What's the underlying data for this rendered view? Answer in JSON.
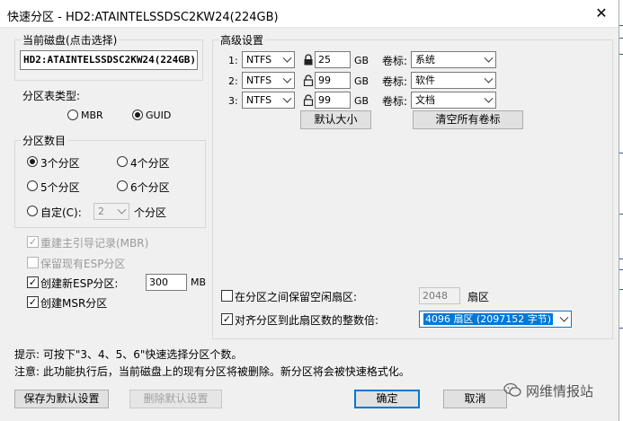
{
  "window": {
    "title": "快速分区 - HD2:ATAINTELSSDSC2KW24(224GB)",
    "close_glyph": "✕"
  },
  "disk": {
    "group_label": "当前磁盘(点击选择)",
    "value": "HD2:ATAINTELSSDSC2KW24(224GB)"
  },
  "partition_table": {
    "label": "分区表类型:",
    "mbr": "MBR",
    "guid": "GUID",
    "selected": "GUID"
  },
  "partition_count": {
    "group_label": "分区数目",
    "options": [
      "3个分区",
      "4个分区",
      "5个分区",
      "6个分区"
    ],
    "custom_label": "自定(C):",
    "custom_value": "2",
    "custom_suffix": "个分区",
    "selected": "3个分区"
  },
  "options_left": {
    "rebuild_mbr": "重建主引导记录(MBR)",
    "keep_esp": "保留现有ESP分区",
    "create_esp": "创建新ESP分区:",
    "esp_size": "300",
    "esp_unit": "MB",
    "create_msr": "创建MSR分区"
  },
  "advanced": {
    "group_label": "高级设置",
    "unit": "GB",
    "volume_label_caption": "卷标:",
    "rows": [
      {
        "index": "1:",
        "fs": "NTFS",
        "size": "25",
        "label": "系统"
      },
      {
        "index": "2:",
        "fs": "NTFS",
        "size": "99",
        "label": "软件"
      },
      {
        "index": "3:",
        "fs": "NTFS",
        "size": "99",
        "label": "文档"
      }
    ],
    "default_size_button": "默认大小",
    "clear_labels_button": "清空所有卷标",
    "reserve_gap_label": "在分区之间保留空闲扇区:",
    "reserve_gap_value": "2048",
    "reserve_gap_unit": "扇区",
    "align_label": "对齐分区到此扇区数的整数倍:",
    "align_value": "4096 扇区 (2097152 字节)"
  },
  "hints": {
    "tip": "提示: 可按下\"3、4、5、6\"快速选择分区个数。",
    "note": "注意: 此功能执行后，当前磁盘上的现有分区将被删除。新分区将会被快速格式化。"
  },
  "buttons": {
    "save_default": "保存为默认设置",
    "delete_default": "删除默认设置",
    "ok": "确定",
    "cancel": "取消"
  },
  "watermark": {
    "text": "网维情报站"
  },
  "colors": {
    "accent": "#0078d7",
    "dialog_bg": "#f0f0f0",
    "right_strip_marks": "#3a5da8"
  }
}
